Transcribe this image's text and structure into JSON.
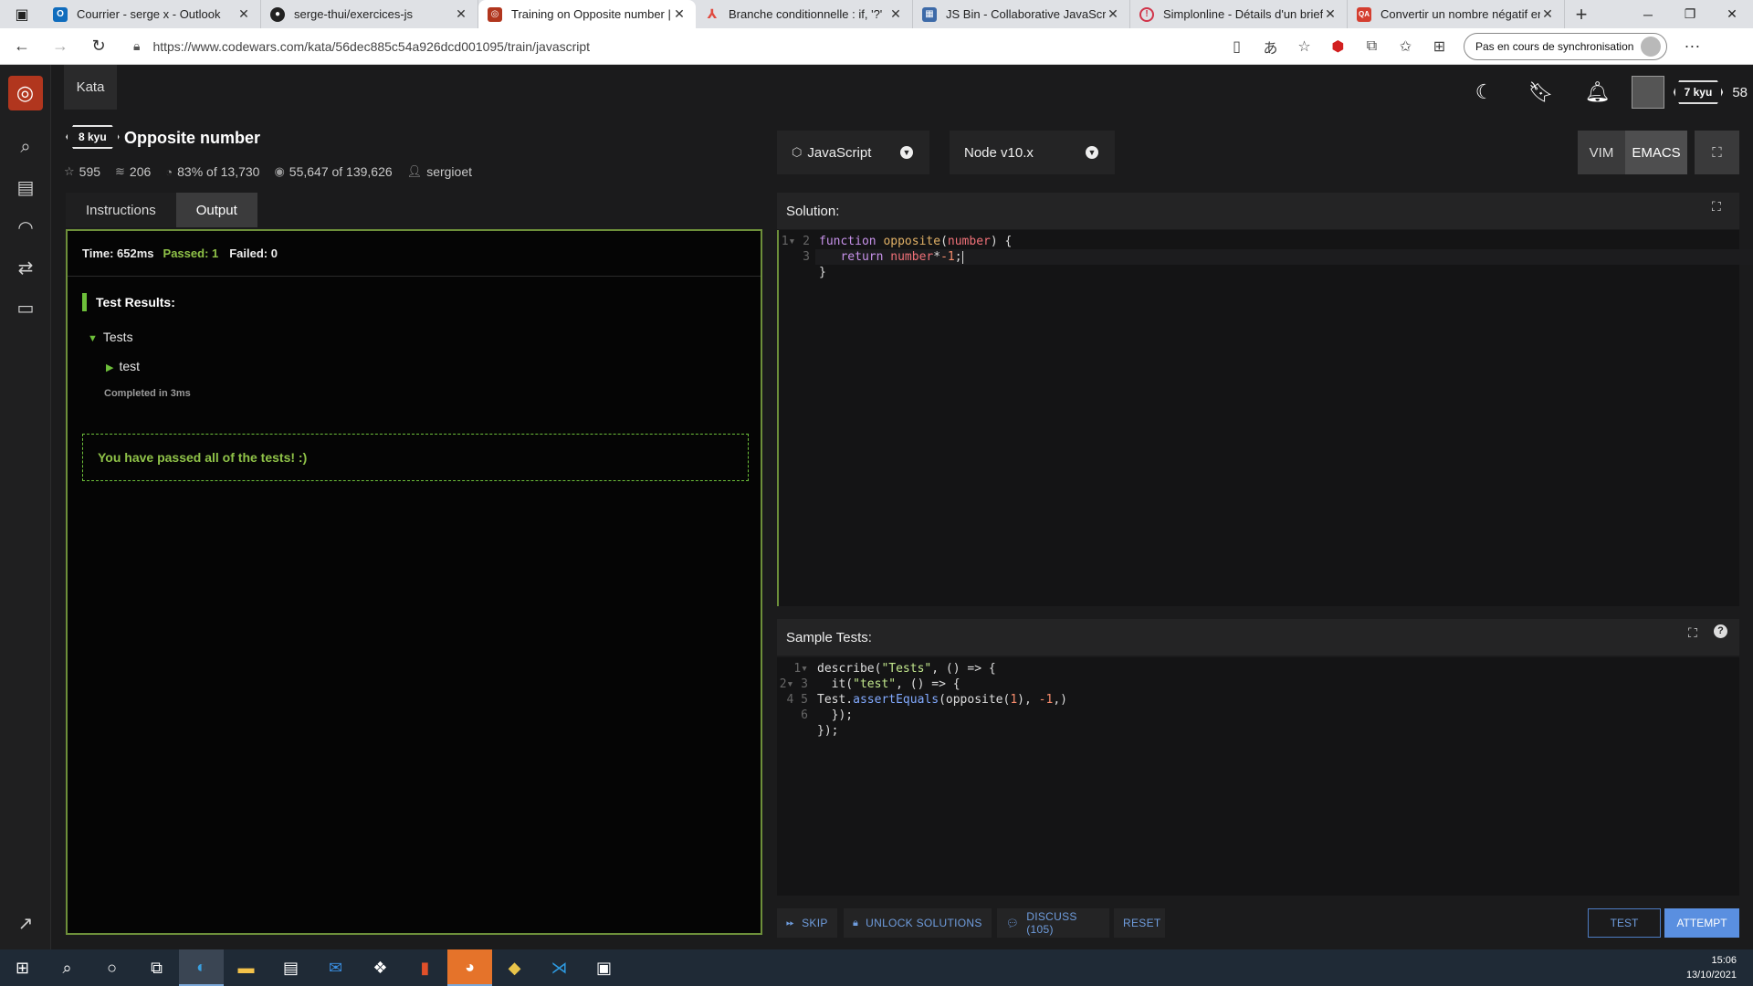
{
  "browser": {
    "tabs": [
      {
        "title": "Courrier - serge x - Outlook",
        "icon": "outlook-icon",
        "color": "#0f6cbd"
      },
      {
        "title": "serge-thui/exercices-js",
        "icon": "github-icon",
        "color": "#222222"
      },
      {
        "title": "Training on Opposite number | C",
        "icon": "codewars-icon",
        "color": "#b1361e"
      },
      {
        "title": "Branche conditionnelle : if, '?'",
        "icon": "javascript-info-icon",
        "color": "#e04a3f"
      },
      {
        "title": "JS Bin - Collaborative JavaScript",
        "icon": "jsbin-icon",
        "color": "#3d6aa8"
      },
      {
        "title": "Simplonline - Détails d'un brief",
        "icon": "simplonline-icon",
        "color": "#d1344a"
      },
      {
        "title": "Convertir un nombre négatif en",
        "icon": "qa-icon",
        "color": "#d43e30"
      }
    ],
    "url": "https://www.codewars.com/kata/56dec885c54a926dcd001095/train/javascript",
    "sync_label": "Pas en cours de synchronisation"
  },
  "header": {
    "kata_link": "Kata",
    "rank": "7 kyu",
    "honor": "58"
  },
  "kata": {
    "rank": "8 kyu",
    "title": "Opposite number",
    "stars": "595",
    "collections": "206",
    "satisfaction": "83% of 13,730",
    "completed": "55,647 of 139,626",
    "author": "sergioet"
  },
  "left_tabs": [
    "Instructions",
    "Output"
  ],
  "output": {
    "time": "Time: 652ms",
    "passed": "Passed: 1",
    "failed": "Failed: 0",
    "results_title": "Test Results:",
    "group": "Tests",
    "test": "test",
    "completed_in": "Completed in 3ms",
    "passed_message": "You have passed all of the tests! :)"
  },
  "editor": {
    "language": "JavaScript",
    "runtime": "Node v10.x",
    "modes": [
      "VIM",
      "EMACS"
    ],
    "solution_title": "Solution:",
    "sample_title": "Sample Tests:"
  },
  "actions": {
    "skip": "SKIP",
    "unlock": "UNLOCK SOLUTIONS",
    "discuss": "DISCUSS (105)",
    "reset": "RESET",
    "test": "TEST",
    "attempt": "ATTEMPT"
  },
  "taskbar": {
    "time": "15:06",
    "date": "13/10/2021"
  }
}
